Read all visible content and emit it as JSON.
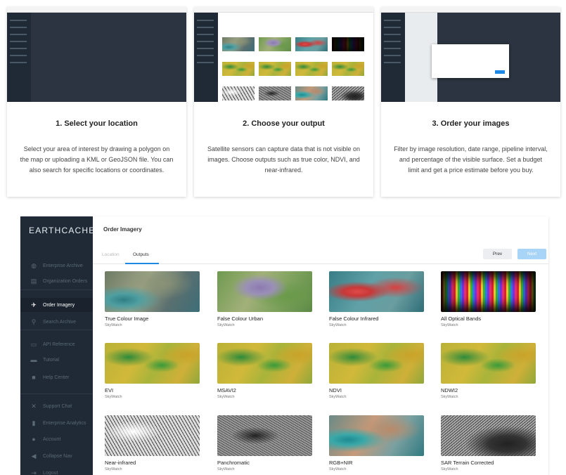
{
  "steps": [
    {
      "heading": "1. Select your location",
      "body": "Select your area of interest by drawing a polygon on the map or uploading a KML or GeoJSON file. You can also search for specific locations or coordinates."
    },
    {
      "heading": "2. Choose your output",
      "body": "Satellite sensors can capture data that is not visible on images. Choose outputs such as true color, NDVI, and near-infrared."
    },
    {
      "heading": "3. Order your images",
      "body": "Filter by image resolution, date range, pipeline interval, and percentage of the visible surface. Set a budget limit and get a price estimate before you buy."
    }
  ],
  "app": {
    "logo": "EARTHCACHE",
    "page_title": "Order Imagery",
    "nav": {
      "items": [
        {
          "label": "Enterprise Archive",
          "icon": "globe-icon",
          "glyph": "◍",
          "active": false
        },
        {
          "label": "Organization Orders",
          "icon": "document-icon",
          "glyph": "▤",
          "active": false
        },
        {
          "label": "Order Imagery",
          "icon": "satellite-icon",
          "glyph": "✈",
          "active": true
        },
        {
          "label": "Search Archive",
          "icon": "search-icon",
          "glyph": "⚲",
          "active": false
        },
        {
          "label": "API Reference",
          "icon": "terminal-icon",
          "glyph": "▭",
          "active": false
        },
        {
          "label": "Tutorial",
          "icon": "video-icon",
          "glyph": "▬",
          "active": false
        },
        {
          "label": "Help Center",
          "icon": "help-icon",
          "glyph": "■",
          "active": false
        },
        {
          "label": "Support Chat",
          "icon": "tools-icon",
          "glyph": "✕",
          "active": false
        },
        {
          "label": "Enterprise Analytics",
          "icon": "bar-chart-icon",
          "glyph": "▮",
          "active": false
        },
        {
          "label": "Account",
          "icon": "user-icon",
          "glyph": "●",
          "active": false
        },
        {
          "label": "Collapse Nav",
          "icon": "chevron-left-icon",
          "glyph": "◀",
          "active": false
        },
        {
          "label": "Logout",
          "icon": "logout-icon",
          "glyph": "⇥",
          "active": false
        }
      ]
    },
    "tabs": {
      "location": "Location",
      "outputs": "Outputs"
    },
    "buttons": {
      "prev": "Prev",
      "next": "Next"
    },
    "outputs": [
      {
        "name": "True Colour Image",
        "source": "SkyWatch",
        "thumb": "t-true"
      },
      {
        "name": "False Colour Urban",
        "source": "SkyWatch",
        "thumb": "t-fcu"
      },
      {
        "name": "False Colour Infrared",
        "source": "SkyWatch",
        "thumb": "t-fci"
      },
      {
        "name": "All Optical Bands",
        "source": "SkyWatch",
        "thumb": "t-bands"
      },
      {
        "name": "EVI",
        "source": "SkyWatch",
        "thumb": "t-idx"
      },
      {
        "name": "MSAVI2",
        "source": "SkyWatch",
        "thumb": "t-idx"
      },
      {
        "name": "NDVI",
        "source": "SkyWatch",
        "thumb": "t-idx"
      },
      {
        "name": "NDWI2",
        "source": "SkyWatch",
        "thumb": "t-idx"
      },
      {
        "name": "Near-infrared",
        "source": "SkyWatch",
        "thumb": "t-nir"
      },
      {
        "name": "Panchromatic",
        "source": "SkyWatch",
        "thumb": "t-pan"
      },
      {
        "name": "RGB+NIR",
        "source": "SkyWatch",
        "thumb": "t-rgbn"
      },
      {
        "name": "SAR Terrain Corrected",
        "source": "SkyWatch",
        "thumb": "t-sar"
      }
    ]
  },
  "colors": {
    "nav_bg": "#1f2a36",
    "accent": "#1e88e5",
    "next_disabled": "#a8d4f7"
  }
}
